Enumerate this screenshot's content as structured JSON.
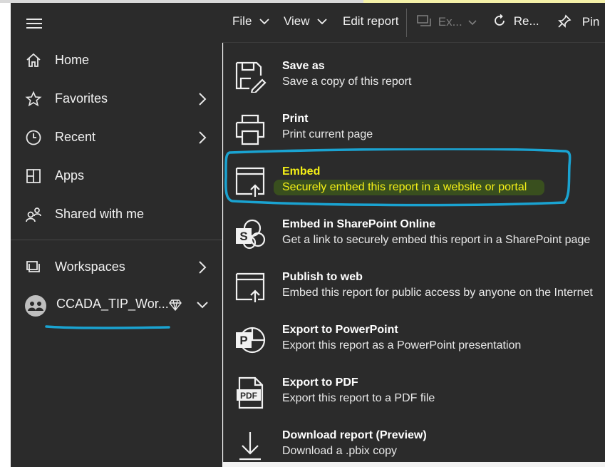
{
  "toolbar": {
    "file_label": "File",
    "view_label": "View",
    "edit_label": "Edit report",
    "export_label": "Ex...",
    "refresh_label": "Re...",
    "pin_label": "Pin"
  },
  "sidebar": {
    "items": [
      {
        "label": "Home",
        "icon": "home-icon",
        "has_chevron": false
      },
      {
        "label": "Favorites",
        "icon": "star-icon",
        "has_chevron": true
      },
      {
        "label": "Recent",
        "icon": "clock-icon",
        "has_chevron": true
      },
      {
        "label": "Apps",
        "icon": "apps-icon",
        "has_chevron": false
      },
      {
        "label": "Shared with me",
        "icon": "shared-icon",
        "has_chevron": false
      }
    ],
    "workspaces_label": "Workspaces",
    "current_workspace": "CCADA_TIP_Wor..."
  },
  "menu": {
    "items": [
      {
        "title": "Save as",
        "description": "Save a copy of this report",
        "icon": "save-as-icon"
      },
      {
        "title": "Print",
        "description": "Print current page",
        "icon": "printer-icon"
      },
      {
        "title": "Embed",
        "description": "Securely embed this report in a website or portal",
        "icon": "embed-icon",
        "highlighted": true
      },
      {
        "title": "Embed in SharePoint Online",
        "description": "Get a link to securely embed this report in a SharePoint page",
        "icon": "sharepoint-icon"
      },
      {
        "title": "Publish to web",
        "description": "Embed this report for public access by anyone on the Internet",
        "icon": "publish-web-icon"
      },
      {
        "title": "Export to PowerPoint",
        "description": "Export this report as a PowerPoint presentation",
        "icon": "powerpoint-icon"
      },
      {
        "title": "Export to PDF",
        "description": "Export this report to a PDF file",
        "icon": "pdf-icon"
      },
      {
        "title": "Download report (Preview)",
        "description": "Download a .pbix copy",
        "icon": "download-icon"
      }
    ]
  },
  "colors": {
    "panel": "#2b2b2b",
    "text": "#f1f1f1",
    "highlight_text": "#f4f016",
    "annotation_blue": "#1aa3d1"
  }
}
